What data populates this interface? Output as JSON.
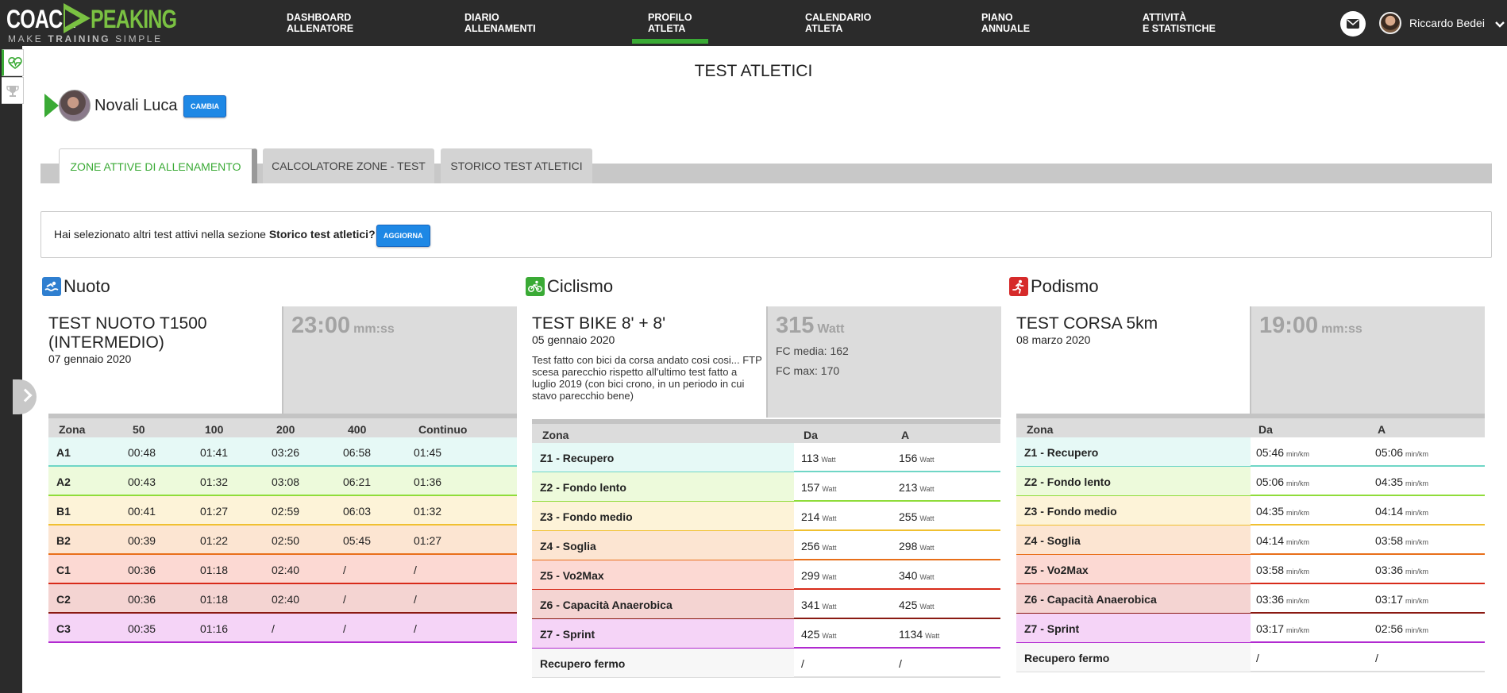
{
  "header": {
    "logo": {
      "word1": "COACH",
      "word2": "PEAKING",
      "tagline_pre": "MAKE ",
      "tagline_bold": "TRAINING",
      "tagline_post": " SIMPLE"
    },
    "nav": [
      {
        "label": "DASHBOARD\nALLENATORE",
        "active": false
      },
      {
        "label": "DIARIO\nALLENAMENTI",
        "active": false
      },
      {
        "label": "PROFILO\nATLETA",
        "active": true
      },
      {
        "label": "CALENDARIO\nATLETA",
        "active": false
      },
      {
        "label": "PIANO\nANNUALE",
        "active": false
      },
      {
        "label": "ATTIVITÀ\nE STATISTICHE",
        "active": false
      }
    ],
    "user_name": "Riccardo Bedei"
  },
  "page_title": "TEST ATLETICI",
  "athlete": {
    "name": "Novali Luca",
    "change_label": "CAMBIA"
  },
  "tabs": [
    {
      "label": "ZONE ATTIVE DI ALLENAMENTO",
      "active": true
    },
    {
      "label": "CALCOLATORE ZONE - TEST",
      "active": false
    },
    {
      "label": "STORICO TEST ATLETICI",
      "active": false
    }
  ],
  "info": {
    "text_pre": "Hai selezionato altri test attivi nella sezione ",
    "text_bold": "Storico test atletici?",
    "button": "AGGIORNA"
  },
  "swim": {
    "sport": "Nuoto",
    "test_title": "TEST NUOTO T1500 (INTERMEDIO)",
    "test_date": "07 gennaio 2020",
    "value": "23:00",
    "unit": "mm:ss",
    "headers": [
      "Zona",
      "50",
      "100",
      "200",
      "400",
      "Continuo"
    ],
    "rows": [
      {
        "zone": "A1",
        "cells": [
          "00:48",
          "01:41",
          "03:26",
          "06:58",
          "01:45"
        ],
        "bg": "#e6f9f6",
        "line": "#6fd6c6"
      },
      {
        "zone": "A2",
        "cells": [
          "00:43",
          "01:32",
          "03:08",
          "06:21",
          "01:36"
        ],
        "bg": "#edfadb",
        "line": "#8fdc3a"
      },
      {
        "zone": "B1",
        "cells": [
          "00:41",
          "01:27",
          "02:59",
          "06:03",
          "01:32"
        ],
        "bg": "#fdf3d8",
        "line": "#f0c030"
      },
      {
        "zone": "B2",
        "cells": [
          "00:39",
          "01:22",
          "02:50",
          "05:45",
          "01:27"
        ],
        "bg": "#fce5d2",
        "line": "#e86f1a"
      },
      {
        "zone": "C1",
        "cells": [
          "00:36",
          "01:18",
          "02:40",
          "/",
          "/"
        ],
        "bg": "#fcd9d3",
        "line": "#d72b1a"
      },
      {
        "zone": "C2",
        "cells": [
          "00:36",
          "01:18",
          "02:40",
          "/",
          "/"
        ],
        "bg": "#f4d4d2",
        "line": "#8a1a12"
      },
      {
        "zone": "C3",
        "cells": [
          "00:35",
          "01:16",
          "/",
          "/",
          "/"
        ],
        "bg": "#f5d4f7",
        "line": "#b12ad0"
      }
    ]
  },
  "bike": {
    "sport": "Ciclismo",
    "test_title": "TEST BIKE 8' + 8'",
    "test_date": "05 gennaio 2020",
    "note": "Test fatto con bici da corsa andato cosi cosi... FTP scesa parecchio rispetto all'ultimo test fatto a luglio 2019 (con bici crono, in un periodo in cui stavo parecchio bene)",
    "value": "315",
    "unit": "Watt",
    "fc_media": "FC media: 162",
    "fc_max": "FC max: 170",
    "headers": [
      "Zona",
      "Da",
      "A"
    ],
    "unit_small": "Watt",
    "rows": [
      {
        "zone": "Z1 - Recupero",
        "from": "113",
        "to": "156",
        "bg": "#e6f9f6",
        "line": "#6fd6c6"
      },
      {
        "zone": "Z2 - Fondo lento",
        "from": "157",
        "to": "213",
        "bg": "#edfadb",
        "line": "#8fdc3a"
      },
      {
        "zone": "Z3 - Fondo medio",
        "from": "214",
        "to": "255",
        "bg": "#fdf3d8",
        "line": "#f0c030"
      },
      {
        "zone": "Z4 - Soglia",
        "from": "256",
        "to": "298",
        "bg": "#fce5d2",
        "line": "#e86f1a"
      },
      {
        "zone": "Z5 - Vo2Max",
        "from": "299",
        "to": "340",
        "bg": "#fcd9d3",
        "line": "#d72b1a"
      },
      {
        "zone": "Z6 - Capacità Anaerobica",
        "from": "341",
        "to": "425",
        "bg": "#f4d4d2",
        "line": "#8a1a12"
      },
      {
        "zone": "Z7 - Sprint",
        "from": "425",
        "to": "1134",
        "bg": "#f5d4f7",
        "line": "#b12ad0"
      },
      {
        "zone": "Recupero fermo",
        "from": "/",
        "to": "/",
        "bg": "#f7f7f7",
        "line": "#dddddd"
      }
    ]
  },
  "run": {
    "sport": "Podismo",
    "test_title": "TEST CORSA 5km",
    "test_date": "08 marzo 2020",
    "value": "19:00",
    "unit": "mm:ss",
    "headers": [
      "Zona",
      "Da",
      "A"
    ],
    "unit_small": "min/km",
    "rows": [
      {
        "zone": "Z1 - Recupero",
        "from": "05:46",
        "to": "05:06",
        "bg": "#e6f9f6",
        "line": "#6fd6c6"
      },
      {
        "zone": "Z2 - Fondo lento",
        "from": "05:06",
        "to": "04:35",
        "bg": "#edfadb",
        "line": "#8fdc3a"
      },
      {
        "zone": "Z3 - Fondo medio",
        "from": "04:35",
        "to": "04:14",
        "bg": "#fdf3d8",
        "line": "#f0c030"
      },
      {
        "zone": "Z4 - Soglia",
        "from": "04:14",
        "to": "03:58",
        "bg": "#fce5d2",
        "line": "#e86f1a"
      },
      {
        "zone": "Z5 - Vo2Max",
        "from": "03:58",
        "to": "03:36",
        "bg": "#fcd9d3",
        "line": "#d72b1a"
      },
      {
        "zone": "Z6 - Capacità Anaerobica",
        "from": "03:36",
        "to": "03:17",
        "bg": "#f4d4d2",
        "line": "#8a1a12"
      },
      {
        "zone": "Z7 - Sprint",
        "from": "03:17",
        "to": "02:56",
        "bg": "#f5d4f7",
        "line": "#b12ad0"
      },
      {
        "zone": "Recupero fermo",
        "from": "/",
        "to": "/",
        "bg": "#f7f7f7",
        "line": "#dddddd"
      }
    ]
  },
  "colors": {
    "accent_green": "#3aaa35",
    "button_blue": "#1e88e5",
    "swim_icon": "#2f7fd0",
    "bike_icon": "#3aaa35",
    "run_icon": "#d62a2a"
  }
}
